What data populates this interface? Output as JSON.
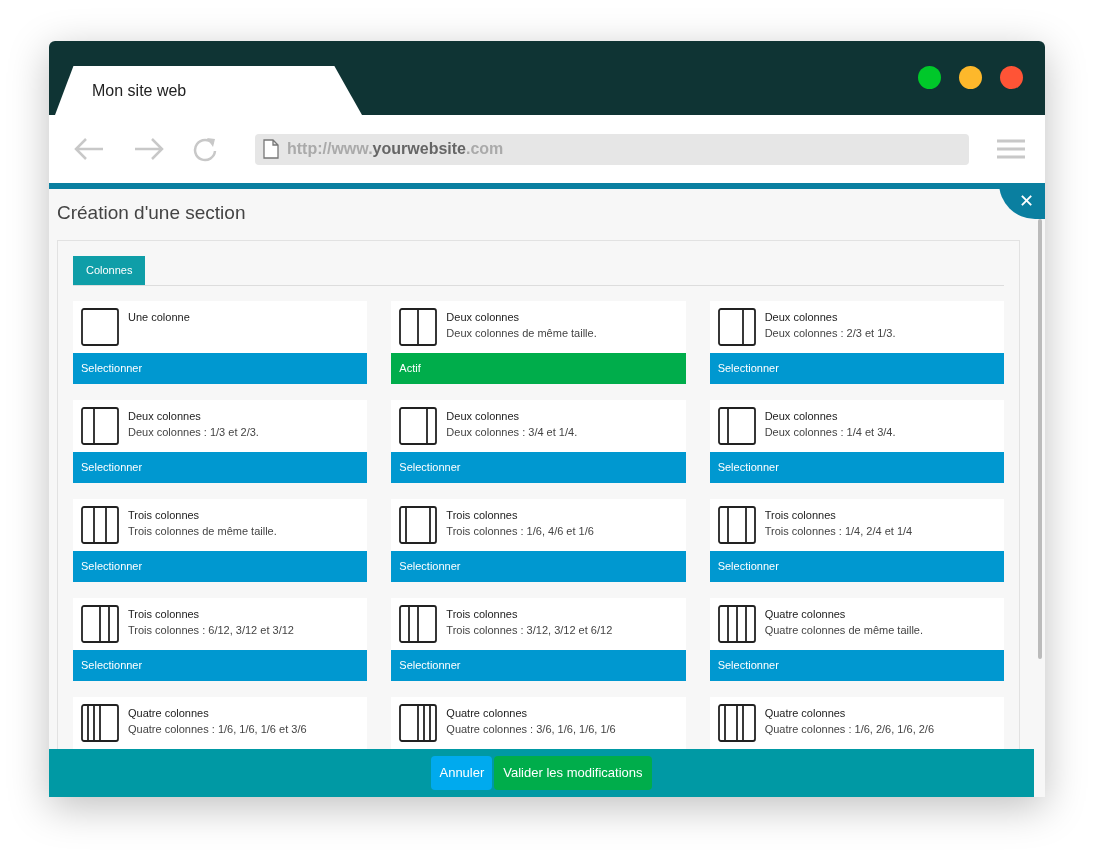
{
  "browser": {
    "tab_title": "Mon site web",
    "url": {
      "prefix": "http://www.",
      "domain": "yourwebsite",
      "suffix": ".com"
    }
  },
  "dialog": {
    "title": "Création d'une section",
    "close": "✕",
    "tabs": [
      {
        "label": "Colonnes",
        "selected": true
      }
    ],
    "cards": [
      {
        "title": "Une colonne",
        "kind": "single",
        "button": "Selectionner",
        "selected": false
      },
      {
        "title": "Deux colonnes",
        "description": "Deux colonnes de même taille.",
        "kind": "halves",
        "button": "Actif",
        "selected": true
      },
      {
        "title": "Deux colonnes",
        "description": "Deux colonnes : 2/3 et 1/3.",
        "kind": "wide-narrow",
        "button": "Selectionner",
        "selected": false
      },
      {
        "title": "Deux colonnes",
        "description": "Deux colonnes : 1/3 et 2/3.",
        "kind": "narrow-wide",
        "button": "Selectionner",
        "selected": false
      },
      {
        "title": "Deux colonnes",
        "description": "Deux colonnes : 3/4 et 1/4.",
        "kind": "large-small",
        "button": "Selectionner",
        "selected": false
      },
      {
        "title": "Deux colonnes",
        "description": "Deux colonnes : 1/4 et 3/4.",
        "kind": "small-large",
        "button": "Selectionner",
        "selected": false
      },
      {
        "title": "Trois colonnes",
        "description": "Trois colonnes de même taille.",
        "kind": "thirds",
        "button": "Selectionner",
        "selected": false
      },
      {
        "title": "Trois colonnes",
        "description": "Trois colonnes : 1/6, 4/6 et 1/6",
        "kind": "slim-center",
        "button": "Selectionner",
        "selected": false
      },
      {
        "title": "Trois colonnes",
        "description": "Trois colonnes : 1/4, 2/4 et 1/4",
        "kind": "wide-center",
        "button": "Selectionner",
        "selected": false
      },
      {
        "title": "Trois colonnes",
        "description": "Trois colonnes : 6/12, 3/12 et 3/12",
        "kind": "wide-first",
        "button": "Selectionner",
        "selected": false
      },
      {
        "title": "Trois colonnes",
        "description": "Trois colonnes : 3/12, 3/12 et 6/12",
        "kind": "wide-last",
        "button": "Selectionner",
        "selected": false
      },
      {
        "title": "Quatre colonnes",
        "description": "Quatre colonnes de même taille.",
        "kind": "quarters",
        "button": "Selectionner",
        "selected": false
      },
      {
        "title": "Quatre colonnes",
        "description": "Quatre colonnes : 1/6, 1/6, 1/6 et 3/6",
        "kind": "four-wide-last"
      },
      {
        "title": "Quatre colonnes",
        "description": "Quatre colonnes : 3/6, 1/6, 1/6, 1/6",
        "kind": "four-wide-first"
      },
      {
        "title": "Quatre colonnes",
        "description": "Quatre colonnes : 1/6, 2/6, 1/6, 2/6",
        "kind": "four-alternating"
      }
    ],
    "buttons": [
      {
        "label": "Annuler",
        "kind": "cancel"
      },
      {
        "label": "Valider les modifications",
        "kind": "confirm"
      }
    ]
  }
}
